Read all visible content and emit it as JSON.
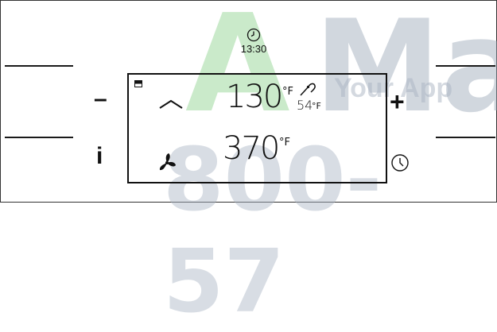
{
  "watermark": {
    "letter_a": "A",
    "letters_m": "Ma",
    "tagline": "Your App",
    "phone": "800-57"
  },
  "clock": {
    "time": "13:30",
    "icon": "clock-icon"
  },
  "controls": {
    "minus_label": "–",
    "plus_label": "+",
    "info_label": "i",
    "timer_icon": "clock-icon"
  },
  "display": {
    "indicator_icon": "battery-icon",
    "row1": {
      "mode_icon": "chevron-up-icon",
      "temperature": "130",
      "unit": "°F",
      "probe_icon": "probe-icon",
      "probe_temperature": "54",
      "probe_unit": "°F"
    },
    "row2": {
      "mode_icon": "fan-icon",
      "temperature": "370",
      "unit": "°F"
    }
  },
  "colors": {
    "line": "#1a1a1a",
    "watermark_green": "#9fd99f",
    "watermark_gray": "#9aa7b8"
  }
}
